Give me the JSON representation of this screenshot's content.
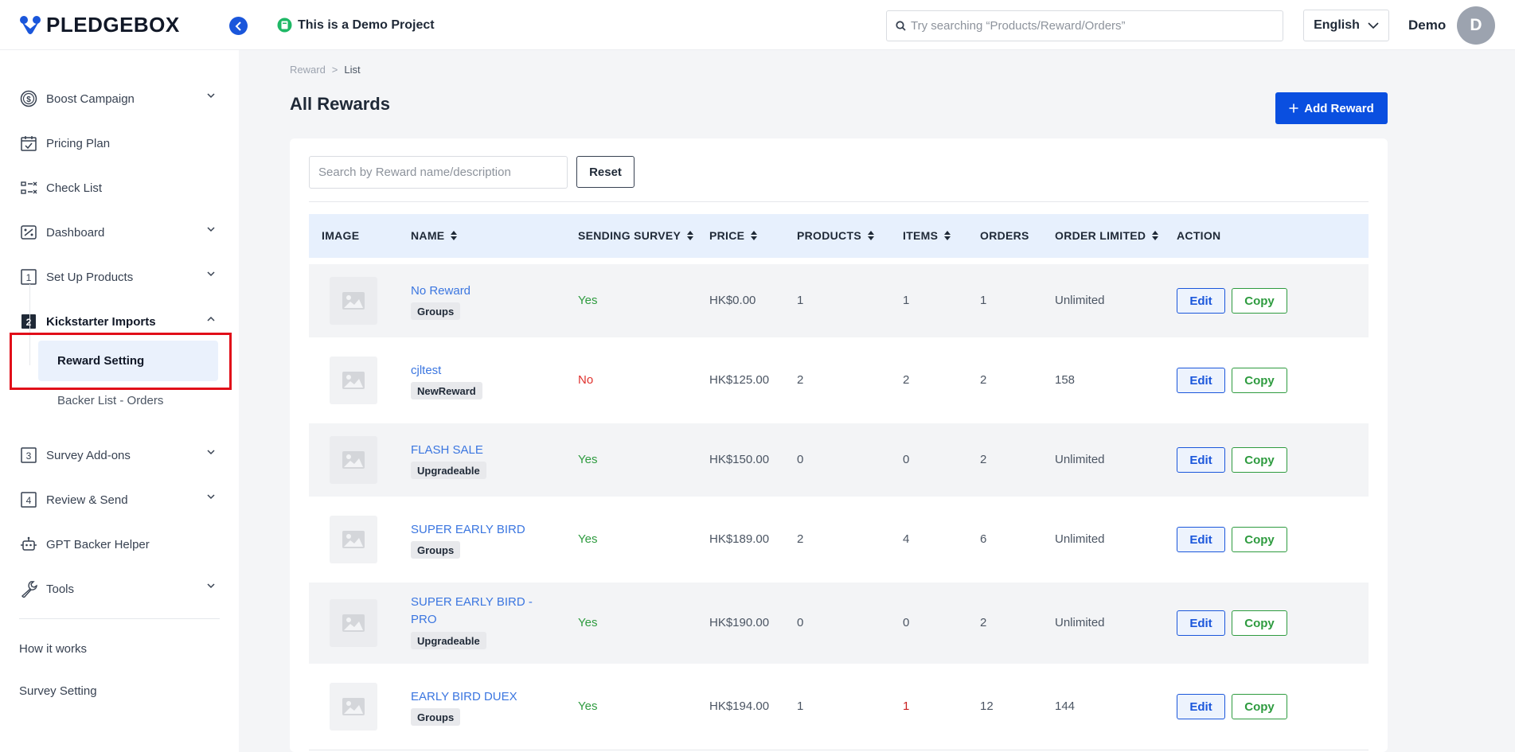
{
  "header": {
    "logo_text": "PLEDGEBOX",
    "project_label": "This is a Demo Project",
    "search_placeholder": "Try searching “Products/Reward/Orders”",
    "language": "English",
    "user_name": "Demo",
    "avatar_initial": "D",
    "accent_color": "#1a56db"
  },
  "sidebar": {
    "items": [
      {
        "label": "Boost Campaign",
        "icon": "dollar-circle-icon"
      },
      {
        "label": "Pricing Plan",
        "icon": "calendar-check-icon"
      },
      {
        "label": "Check List",
        "icon": "checklist-icon"
      },
      {
        "label": "Dashboard",
        "icon": "percent-chart-icon"
      },
      {
        "label": "Set Up Products",
        "icon": "step-one-icon"
      },
      {
        "label": "Kickstarter Imports",
        "icon": "step-two-icon"
      },
      {
        "label": "Survey Add-ons",
        "icon": "step-three-icon"
      },
      {
        "label": "Review & Send",
        "icon": "step-four-icon"
      },
      {
        "label": "GPT Backer Helper",
        "icon": "robot-icon"
      },
      {
        "label": "Tools",
        "icon": "wrench-icon"
      }
    ],
    "sub_items": [
      {
        "label": "Reward Setting"
      },
      {
        "label": "Backer List - Orders"
      }
    ],
    "links": [
      {
        "label": "How it works"
      },
      {
        "label": "Survey Setting"
      }
    ],
    "step_numbers": [
      "1",
      "2",
      "3",
      "4"
    ]
  },
  "main": {
    "breadcrumb": {
      "parent": "Reward",
      "separator": ">",
      "current": "List"
    },
    "title": "All Rewards",
    "add_button_label": "Add Reward",
    "filter_placeholder": "Search by Reward name/description",
    "reset_label": "Reset",
    "columns": [
      "IMAGE",
      "NAME",
      "SENDING SURVEY",
      "PRICE",
      "PRODUCTS",
      "ITEMS",
      "ORDERS",
      "ORDER LIMITED",
      "ACTION"
    ],
    "edit_label": "Edit",
    "copy_label": "Copy",
    "rows": [
      {
        "name": "No Reward",
        "tag": "Groups",
        "survey": "Yes",
        "price": "HK$0.00",
        "products": "1",
        "items": "1",
        "orders": "1",
        "limited": "Unlimited"
      },
      {
        "name": "cjltest",
        "tag": "NewReward",
        "survey": "No",
        "price": "HK$125.00",
        "products": "2",
        "items": "2",
        "orders": "2",
        "limited": "158"
      },
      {
        "name": "FLASH SALE",
        "tag": "Upgradeable",
        "survey": "Yes",
        "price": "HK$150.00",
        "products": "0",
        "items": "0",
        "orders": "2",
        "limited": "Unlimited"
      },
      {
        "name": "SUPER EARLY BIRD",
        "tag": "Groups",
        "survey": "Yes",
        "price": "HK$189.00",
        "products": "2",
        "items": "4",
        "orders": "6",
        "limited": "Unlimited"
      },
      {
        "name": "SUPER EARLY BIRD - PRO",
        "tag": "Upgradeable",
        "survey": "Yes",
        "price": "HK$190.00",
        "products": "0",
        "items": "0",
        "orders": "2",
        "limited": "Unlimited"
      },
      {
        "name": "EARLY BIRD DUEX",
        "tag": "Groups",
        "survey": "Yes",
        "price": "HK$194.00",
        "products": "1",
        "items": "1",
        "orders": "12",
        "limited": "144"
      }
    ]
  }
}
